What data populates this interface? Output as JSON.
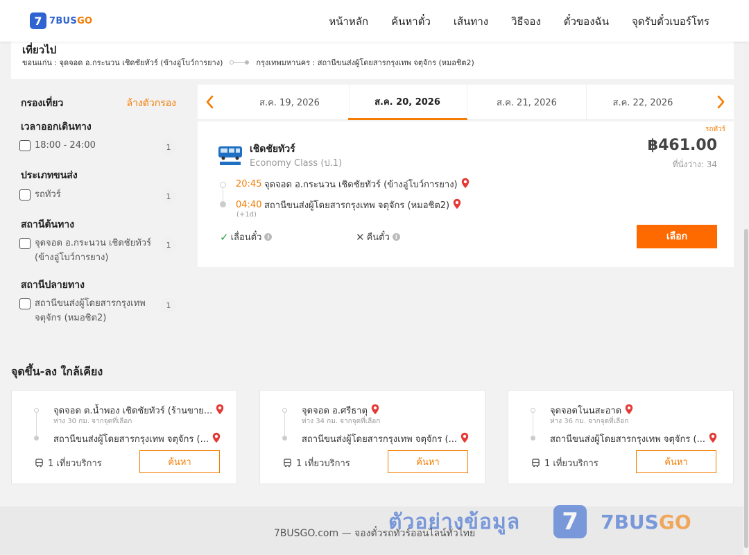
{
  "header": {
    "logo_num": "7",
    "logo_main": "7BUS",
    "logo_go": "GO",
    "nav": [
      "หน้าหลัก",
      "ค้นหาตั๋ว",
      "เส้นทาง",
      "วิธีจอง",
      "ตั๋วของฉัน",
      "จุดรับตั๋วเบอร์โทร"
    ]
  },
  "trip": {
    "title": "เที่ยวไป",
    "from": "ขอนแก่น : จุดจอด อ.กระนวน เชิดชัยทัวร์ (ข้างอู่โบว์การยาง)",
    "to": "กรุงเทพมหานคร : สถานีขนส่งผู้โดยสารกรุงเทพ จตุจักร (หมอชิต2)"
  },
  "filter": {
    "title": "กรองเที่ยว",
    "clear": "ล้างตัวกรอง",
    "groups": [
      {
        "title": "เวลาออกเดินทาง",
        "option": "18:00 - 24:00",
        "count": "1"
      },
      {
        "title": "ประเภทขนส่ง",
        "option": "รถทัวร์",
        "count": "1"
      },
      {
        "title": "สถานีต้นทาง",
        "option": "จุดจอด อ.กระนวน เชิดชัยทัวร์ (ข้างอู่โบว์การยาง)",
        "count": "1"
      },
      {
        "title": "สถานีปลายทาง",
        "option": "สถานีขนส่งผู้โดยสารกรุงเทพ จตุจักร (หมอชิต2)",
        "count": "1"
      }
    ]
  },
  "dates": [
    "ส.ค. 19, 2026",
    "ส.ค. 20, 2026",
    "ส.ค. 21, 2026",
    "ส.ค. 22, 2026"
  ],
  "result": {
    "tag": "รถทัวร์",
    "operator": "เชิดชัยทัวร์",
    "class": "Economy Class (ป.1)",
    "price": "฿461.00",
    "seats": "ที่นั่งว่าง: 34",
    "dep_time": "20:45",
    "dep_place": "จุดจอด อ.กระนวน เชิดชัยทัวร์ (ข้างอู่โบว์การยาง)",
    "arr_time": "04:40",
    "arr_place": "สถานีขนส่งผู้โดยสารกรุงเทพ จตุจักร (หมอชิต2)",
    "plus_day": "(+1d)",
    "reschedule": "เลื่อนตั๋ว",
    "refund": "คืนตั๋ว",
    "select": "เลือก"
  },
  "nearby": {
    "title": "จุดขึ้น-ลง ใกล้เคียง",
    "cards": [
      {
        "from": "จุดจอด ต.น้ำพอง เชิดชัยทัวร์ (ร้านขาย...",
        "dist": "ห่าง 30 กม. จากจุดที่เลือก",
        "to": "สถานีขนส่งผู้โดยสารกรุงเทพ จตุจักร (...",
        "trips": "1 เที่ยวบริการ",
        "btn": "ค้นหา"
      },
      {
        "from": "จุดจอด อ.ศรีธาตุ",
        "dist": "ห่าง 34 กม. จากจุดที่เลือก",
        "to": "สถานีขนส่งผู้โดยสารกรุงเทพ จตุจักร (...",
        "trips": "1 เที่ยวบริการ",
        "btn": "ค้นหา"
      },
      {
        "from": "จุดจอดโนนสะอาด",
        "dist": "ห่าง 36 กม. จากจุดที่เลือก",
        "to": "สถานีขนส่งผู้โดยสารกรุงเทพ จตุจักร (...",
        "trips": "1 เที่ยวบริการ",
        "btn": "ค้นหา"
      }
    ]
  },
  "footer": {
    "text": "7BUSGO.com — จองตั๋วรถทัวร์ออนไลน์ทั่วไทย"
  },
  "watermark": {
    "text": "ตัวอย่างข้อมูล",
    "brand_main": "7BUS",
    "brand_go": "GO",
    "mark": "7"
  },
  "colors": {
    "accent": "#f57c00",
    "button": "#ff6a00",
    "brand": "#2f63d1"
  },
  "icons": [
    "location-pin-icon",
    "check-icon",
    "cross-icon",
    "info-icon",
    "bus-icon",
    "chevron-left-icon",
    "chevron-right-icon"
  ]
}
